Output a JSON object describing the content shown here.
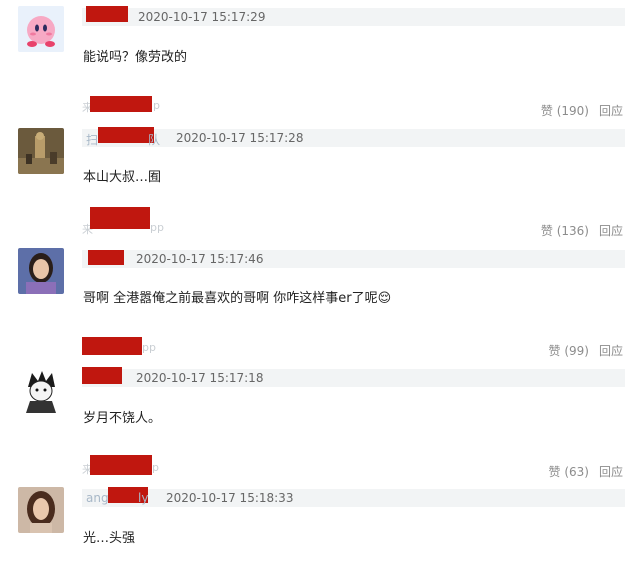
{
  "comments": [
    {
      "time": "2020-10-17 15:17:29",
      "text": "能说吗？像劳改的",
      "nick_visible": "",
      "from": "",
      "likes": "",
      "reply": ""
    },
    {
      "time": "2020-10-17 15:17:28",
      "text": "本山大叔…囿",
      "nick_visible_left": "扫",
      "nick_visible_right": "队",
      "from_prefix": "来",
      "from_suffix": "p",
      "likes": "赞 (190)",
      "reply": "回应"
    },
    {
      "time": "2020-10-17 15:17:46",
      "text": "哥啊 全港嚣俺之前最喜欢的哥啊 你咋这样事er了呢😌",
      "from_prefix": "来",
      "from_suffix": "pp",
      "likes": "赞 (136)",
      "reply": "回应"
    },
    {
      "time": "2020-10-17 15:17:18",
      "text": "岁月不饶人。",
      "from_suffix": "pp",
      "likes": "赞 (99)",
      "reply": "回应"
    },
    {
      "time": "2020-10-17 15:18:33",
      "text": "光…头强",
      "nick_visible_left": "ang",
      "nick_visible_right": "ly",
      "from_prefix": "来",
      "from_suffix": "p",
      "likes": "赞 (63)",
      "reply": "回应"
    }
  ]
}
